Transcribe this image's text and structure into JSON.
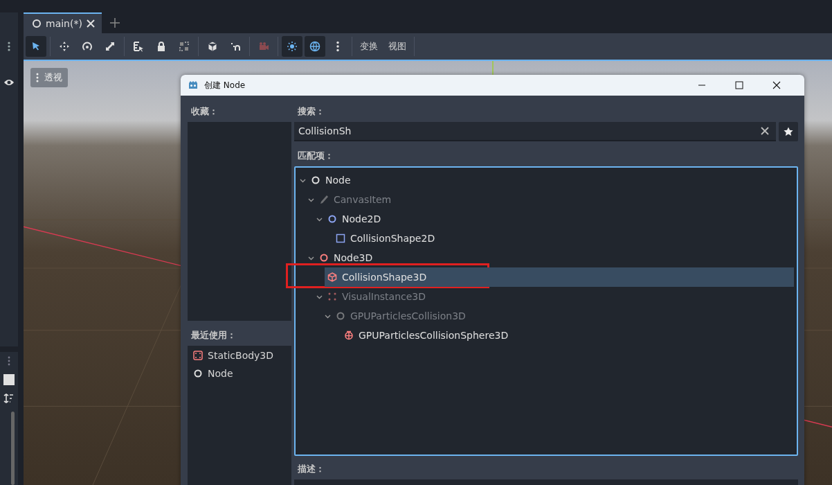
{
  "editor_tabs": [
    {
      "label": "main(*)",
      "selected": true
    }
  ],
  "toolbar": {
    "tool_groups": [
      [
        {
          "kind": "select",
          "on": true
        }
      ],
      [
        {
          "kind": "move",
          "on": false
        },
        {
          "kind": "rotate",
          "on": false
        },
        {
          "kind": "scale",
          "on": false
        }
      ],
      [
        {
          "kind": "list-select",
          "on": false
        },
        {
          "kind": "lock",
          "on": false
        },
        {
          "kind": "group",
          "on": false
        }
      ],
      [
        {
          "kind": "cube",
          "on": false
        },
        {
          "kind": "snap",
          "on": false
        }
      ],
      [
        {
          "kind": "camera",
          "on": false
        }
      ],
      [
        {
          "kind": "sun",
          "on": true
        },
        {
          "kind": "globe",
          "on": true
        },
        {
          "kind": "more",
          "on": false
        }
      ]
    ],
    "menus": [
      "变换",
      "视图"
    ]
  },
  "viewport": {
    "view_menu": "透视"
  },
  "dialog": {
    "title": "创建 Node",
    "favorites_label": "收藏：",
    "recent_label": "最近使用：",
    "recent": [
      {
        "kind": "static-body",
        "label": "StaticBody3D"
      },
      {
        "kind": "node",
        "label": "Node"
      }
    ],
    "search_label": "搜索：",
    "search": {
      "value": "CollisionSh"
    },
    "matches_label": "匹配项：",
    "matches": [
      {
        "kind": "node",
        "label": "Node",
        "dimmed": false,
        "selected": false,
        "expanded": true,
        "children": [
          {
            "kind": "canvas-item",
            "label": "CanvasItem",
            "dimmed": true,
            "selected": false,
            "expanded": true,
            "children": [
              {
                "kind": "node2d",
                "label": "Node2D",
                "dimmed": false,
                "selected": false,
                "expanded": true,
                "children": [
                  {
                    "kind": "shape2d",
                    "label": "CollisionShape2D",
                    "dimmed": false,
                    "selected": false
                  }
                ]
              }
            ]
          },
          {
            "kind": "node3d",
            "label": "Node3D",
            "dimmed": false,
            "selected": false,
            "expanded": true,
            "children": [
              {
                "kind": "shape3d",
                "label": "CollisionShape3D",
                "dimmed": false,
                "selected": true,
                "annotated": true
              },
              {
                "kind": "visual3d",
                "label": "VisualInstance3D",
                "dimmed": true,
                "selected": false,
                "expanded": true,
                "children": [
                  {
                    "kind": "particles-collision",
                    "label": "GPUParticlesCollision3D",
                    "dimmed": true,
                    "selected": false,
                    "expanded": true,
                    "children": [
                      {
                        "kind": "particles-sphere",
                        "label": "GPUParticlesCollisionSphere3D",
                        "dimmed": false,
                        "selected": false
                      }
                    ]
                  }
                ]
              }
            ]
          }
        ]
      }
    ],
    "description_label": "描述："
  }
}
